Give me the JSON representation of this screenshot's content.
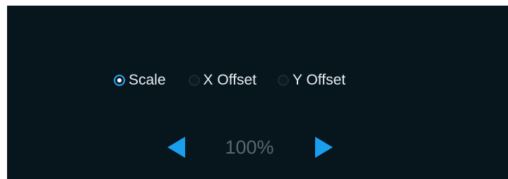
{
  "options": [
    {
      "label": "Scale",
      "selected": true
    },
    {
      "label": "X Offset",
      "selected": false
    },
    {
      "label": "Y Offset",
      "selected": false
    }
  ],
  "adjuster": {
    "value": "100%",
    "prev_icon": "arrow-left-icon",
    "next_icon": "arrow-right-icon"
  },
  "colors": {
    "background": "#07151c",
    "accent": "#1a9eee",
    "label_text": "#e7eef2",
    "value_text": "#5a6670"
  }
}
